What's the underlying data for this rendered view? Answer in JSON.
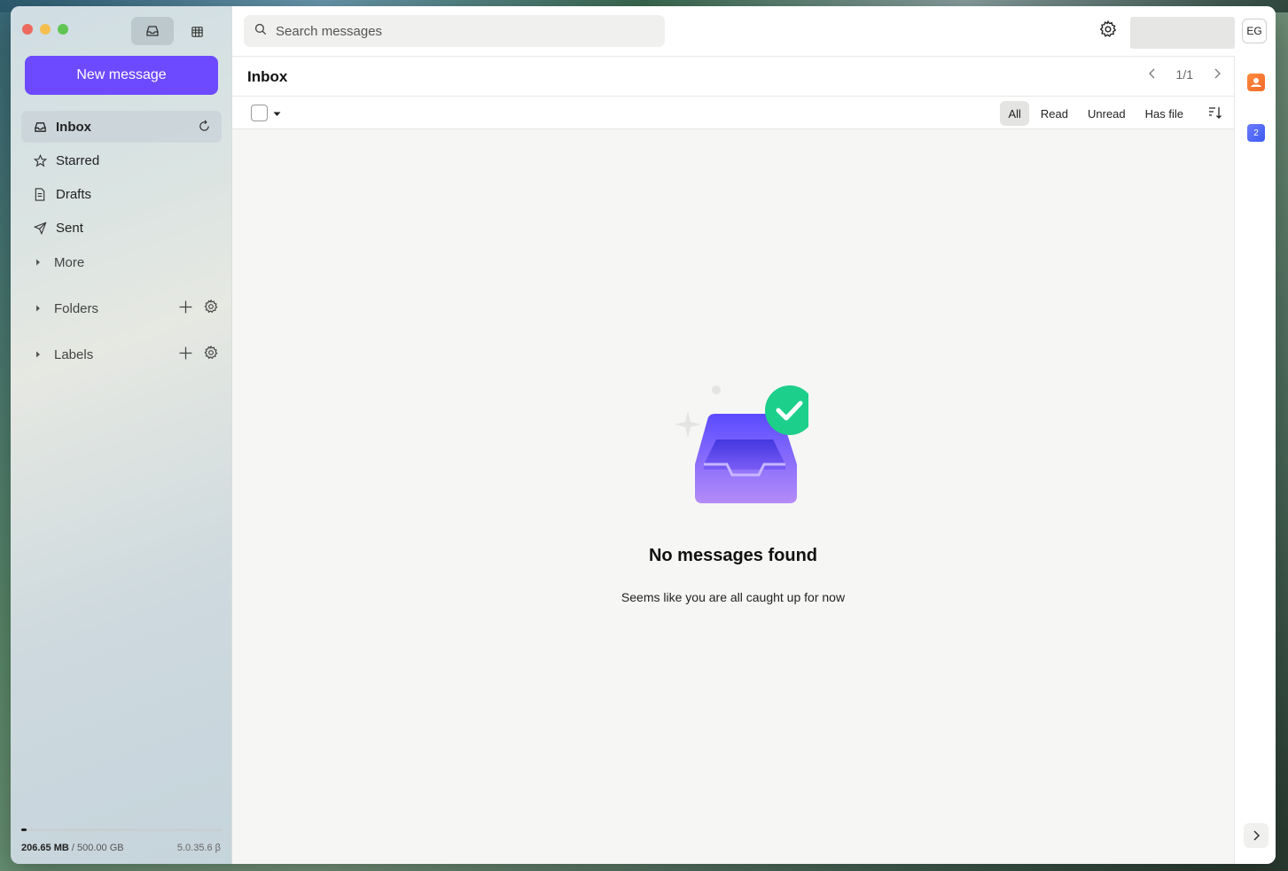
{
  "sidebar": {
    "new_message": "New message",
    "items": [
      {
        "label": "Inbox",
        "icon": "inbox-icon"
      },
      {
        "label": "Starred",
        "icon": "star-icon"
      },
      {
        "label": "Drafts",
        "icon": "draft-icon"
      },
      {
        "label": "Sent",
        "icon": "sent-icon"
      }
    ],
    "more": "More",
    "folders": "Folders",
    "labels": "Labels",
    "storage_used": "206.65 MB",
    "storage_total": "/ 500.00 GB",
    "storage_fraction": 0.0004,
    "version": "5.0.35.6 β"
  },
  "topbar": {
    "search_placeholder": "Search messages",
    "avatar_initials": "EG"
  },
  "main": {
    "title": "Inbox",
    "pager": "1/1",
    "filters": [
      "All",
      "Read",
      "Unread",
      "Has file"
    ],
    "active_filter": "All",
    "empty_title": "No messages found",
    "empty_subtitle": "Seems like you are all caught up for now"
  },
  "rail": {
    "calendar_badge": "2"
  },
  "colors": {
    "accent": "#6d4aff",
    "success": "#1ccf8a"
  }
}
